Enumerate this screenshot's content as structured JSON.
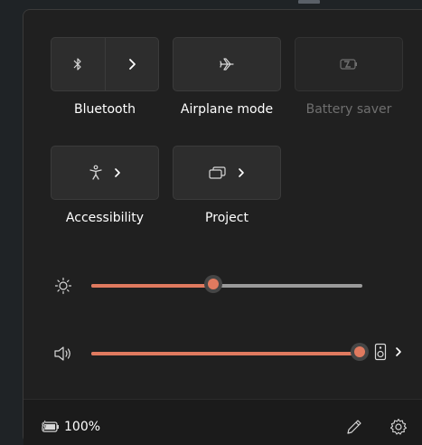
{
  "tiles": [
    {
      "label": "Bluetooth",
      "icon": "bluetooth-icon",
      "disabled": false
    },
    {
      "label": "Airplane mode",
      "icon": "airplane-icon",
      "disabled": false
    },
    {
      "label": "Battery saver",
      "icon": "battery-saver-icon",
      "disabled": true
    },
    {
      "label": "Accessibility",
      "icon": "accessibility-icon",
      "disabled": false
    },
    {
      "label": "Project",
      "icon": "project-icon",
      "disabled": false
    }
  ],
  "brightness": {
    "icon": "sun-icon",
    "level": 0.45
  },
  "volume": {
    "icon": "speaker-icon",
    "level": 1.0,
    "output_icon": "audio-output-icon"
  },
  "footer": {
    "battery_percent": "100%",
    "battery_icon": "battery-charging-icon"
  },
  "colors": {
    "accent": "#e07a5f",
    "panel": "#202020",
    "tile": "#2d2d2d",
    "disabled_text": "#6f6f6f"
  }
}
